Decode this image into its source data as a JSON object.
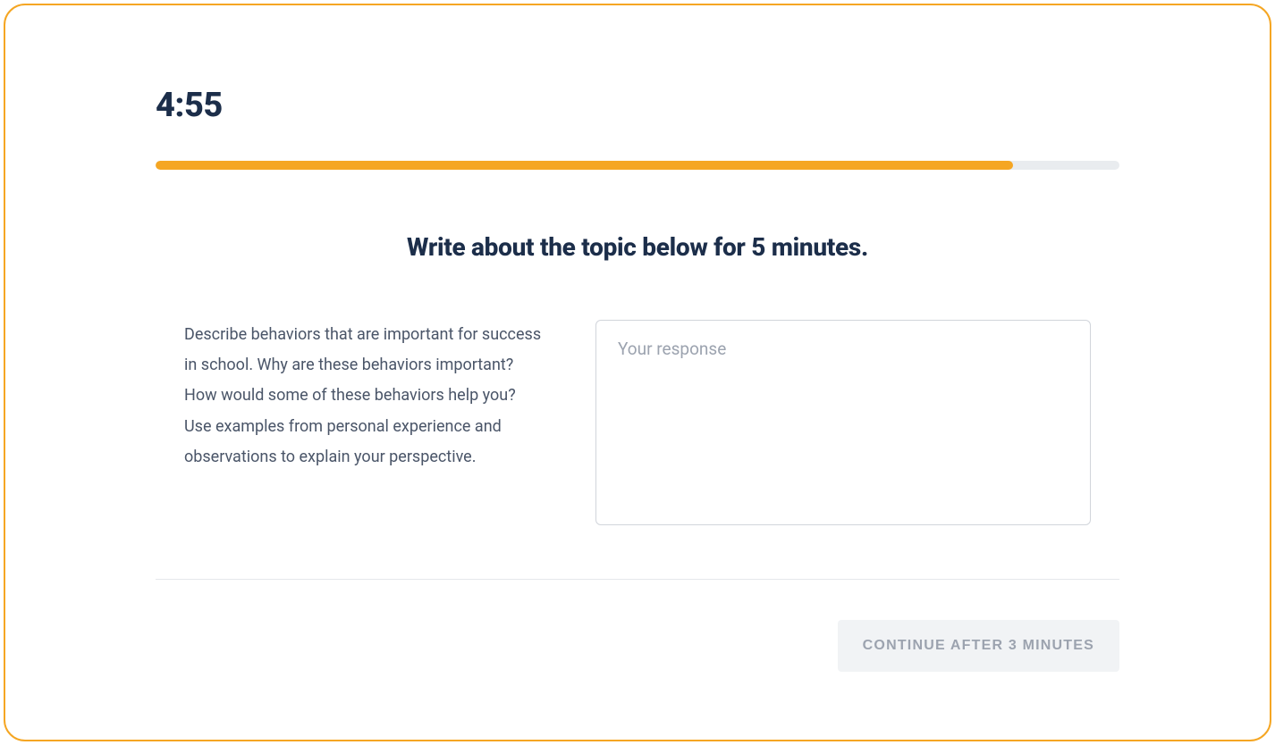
{
  "timer": {
    "display": "4:55"
  },
  "progress": {
    "percent": 89
  },
  "instruction": {
    "title": "Write about the topic below for 5 minutes."
  },
  "prompt": {
    "text": "Describe behaviors that are important for success in school. Why are these behaviors important? How would some of these behaviors help you? Use examples from personal experience and observations to explain your perspective."
  },
  "response": {
    "value": "",
    "placeholder": "Your response"
  },
  "actions": {
    "continue_label": "CONTINUE AFTER 3 MINUTES"
  },
  "colors": {
    "accent": "#f5a623",
    "dark_navy": "#1c2e4a",
    "gray_text": "#4a5568",
    "placeholder_gray": "#9ca3af",
    "disabled_bg": "#f1f3f5"
  }
}
